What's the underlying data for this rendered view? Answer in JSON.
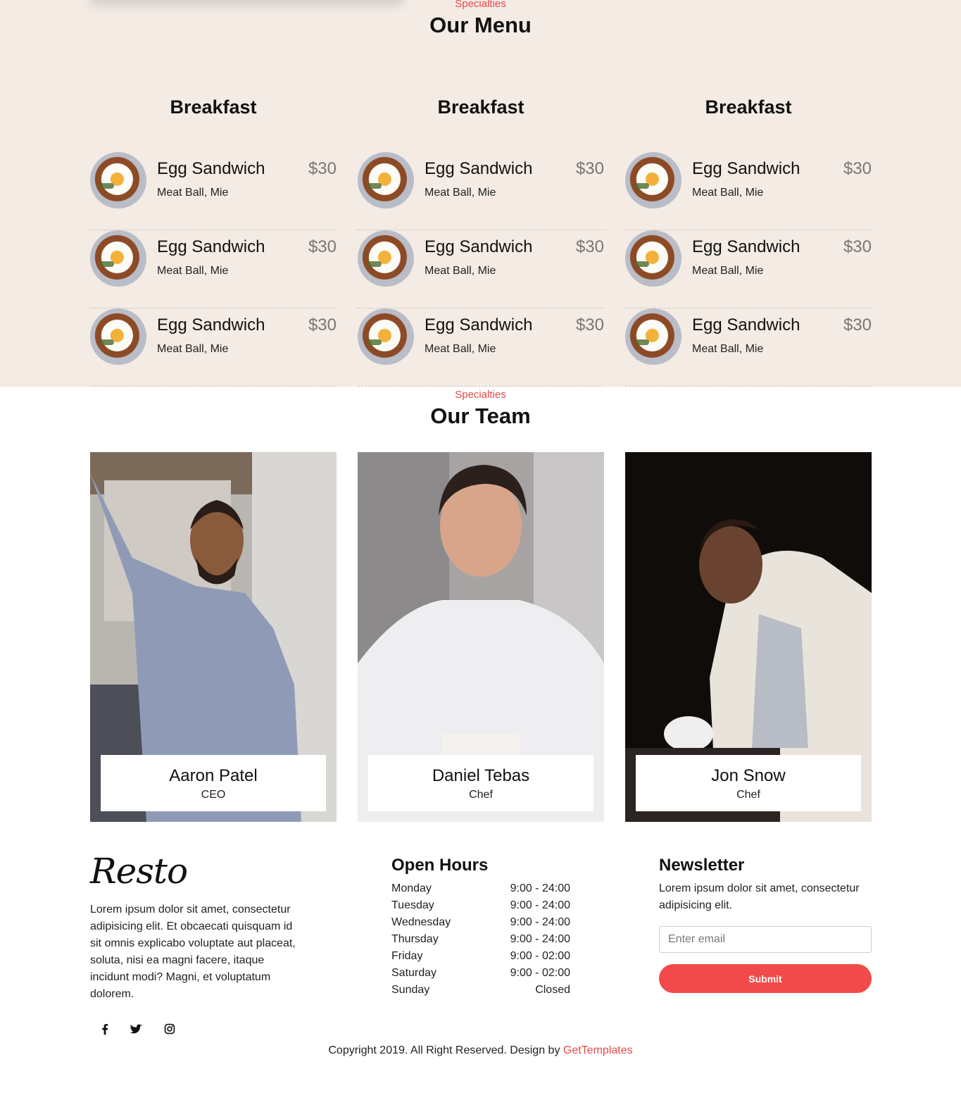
{
  "menu": {
    "eyebrow": "Specialties",
    "title": "Our Menu",
    "columns": [
      {
        "title": "Breakfast",
        "items": [
          {
            "name": "Egg Sandwich",
            "price": "$30",
            "desc": "Meat Ball, Mie"
          },
          {
            "name": "Egg Sandwich",
            "price": "$30",
            "desc": "Meat Ball, Mie"
          },
          {
            "name": "Egg Sandwich",
            "price": "$30",
            "desc": "Meat Ball, Mie"
          }
        ]
      },
      {
        "title": "Breakfast",
        "items": [
          {
            "name": "Egg Sandwich",
            "price": "$30",
            "desc": "Meat Ball, Mie"
          },
          {
            "name": "Egg Sandwich",
            "price": "$30",
            "desc": "Meat Ball, Mie"
          },
          {
            "name": "Egg Sandwich",
            "price": "$30",
            "desc": "Meat Ball, Mie"
          }
        ]
      },
      {
        "title": "Breakfast",
        "items": [
          {
            "name": "Egg Sandwich",
            "price": "$30",
            "desc": "Meat Ball, Mie"
          },
          {
            "name": "Egg Sandwich",
            "price": "$30",
            "desc": "Meat Ball, Mie"
          },
          {
            "name": "Egg Sandwich",
            "price": "$30",
            "desc": "Meat Ball, Mie"
          }
        ]
      }
    ]
  },
  "team": {
    "eyebrow": "Specialties",
    "title": "Our Team",
    "members": [
      {
        "name": "Aaron Patel",
        "role": "CEO"
      },
      {
        "name": "Daniel Tebas",
        "role": "Chef"
      },
      {
        "name": "Jon Snow",
        "role": "Chef"
      }
    ]
  },
  "footer": {
    "logo": "Resto",
    "about": "Lorem ipsum dolor sit amet, consectetur adipisicing elit. Et obcaecati quisquam id sit omnis explicabo voluptate aut placeat, soluta, nisi ea magni facere, itaque incidunt modi? Magni, et voluptatum dolorem.",
    "social_icons": [
      "facebook-icon",
      "twitter-icon",
      "instagram-icon"
    ],
    "hours": {
      "title": "Open Hours",
      "rows": [
        {
          "day": "Monday",
          "time": "9:00 - 24:00"
        },
        {
          "day": "Tuesday",
          "time": "9:00 - 24:00"
        },
        {
          "day": "Wednesday",
          "time": "9:00 - 24:00"
        },
        {
          "day": "Thursday",
          "time": "9:00 - 24:00"
        },
        {
          "day": "Friday",
          "time": "9:00 - 02:00"
        },
        {
          "day": "Saturday",
          "time": "9:00 - 02:00"
        },
        {
          "day": "Sunday",
          "time": "Closed"
        }
      ]
    },
    "newsletter": {
      "title": "Newsletter",
      "text": "Lorem ipsum dolor sit amet, consectetur adipisicing elit.",
      "placeholder": "Enter email",
      "submit_label": "Submit"
    },
    "copyright_text": "Copyright 2019. All Right Reserved. Design by",
    "copyright_link": "GetTemplates"
  },
  "colors": {
    "accent": "#f24a4a",
    "menu_background": "#f3ebe4"
  }
}
